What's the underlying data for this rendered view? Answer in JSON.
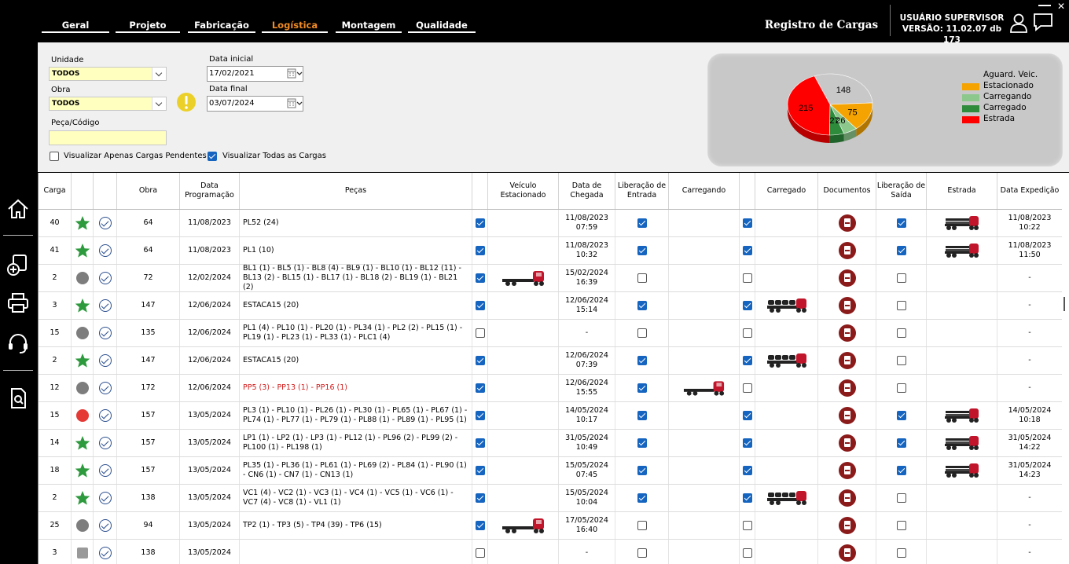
{
  "nav": {
    "tabs": [
      {
        "label": "Geral",
        "active": false
      },
      {
        "label": "Projeto",
        "active": false
      },
      {
        "label": "Fabricação",
        "active": false
      },
      {
        "label": "Logística",
        "active": true
      },
      {
        "label": "Montagem",
        "active": false
      },
      {
        "label": "Qualidade",
        "active": false
      }
    ],
    "app_title": "Registro de Cargas",
    "user": "USUÁRIO SUPERVISOR",
    "version": "VERSÃO: 11.02.07 db 173",
    "close": "✕"
  },
  "sidebar": [
    "home-icon",
    "add-document-icon",
    "printer-icon",
    "headset-icon",
    "search-document-icon"
  ],
  "filters": {
    "unidade_label": "Unidade",
    "unidade_value": "TODOS",
    "obra_label": "Obra",
    "obra_value": "TODOS",
    "peca_label": "Peça/Código",
    "peca_value": "",
    "data_inicial_label": "Data inicial",
    "data_inicial": "17/02/2021",
    "data_final_label": "Data final",
    "data_final": "03/07/2024",
    "pendentes_label": "Visualizar Apenas Cargas Pendentes",
    "pendentes_checked": false,
    "todas_label": "Visualizar Todas as Cargas",
    "todas_checked": true
  },
  "chart_data": {
    "type": "pie",
    "title": "",
    "labels": [
      "Aguard. Veic.",
      "Estacionado",
      "Carregando",
      "Carregado",
      "Estrada"
    ],
    "values": [
      148,
      75,
      26,
      27,
      215
    ],
    "colors": [
      "#c8c8c8",
      "#f5a300",
      "#8cc88c",
      "#2e8b3c",
      "#ff0000"
    ],
    "legend_position": "right"
  },
  "table": {
    "headers": [
      {
        "label": "Carga"
      },
      {
        "label": ""
      },
      {
        "label": ""
      },
      {
        "label": "Obra"
      },
      {
        "label": "Data Programação"
      },
      {
        "label": "Peças"
      },
      {
        "label": ""
      },
      {
        "label": "Veículo Estacionado"
      },
      {
        "label": "Data de Chegada"
      },
      {
        "label": "Liberação de Entrada"
      },
      {
        "label": "Carregando"
      },
      {
        "label": ""
      },
      {
        "label": "Carregado"
      },
      {
        "label": "Documentos"
      },
      {
        "label": "Liberação de Saída"
      },
      {
        "label": "Estrada"
      },
      {
        "label": "Data Expedição"
      }
    ],
    "rows": [
      {
        "carga": "40",
        "status": "star",
        "obra": "64",
        "data_prog": "11/08/2023",
        "pecas": "PL52 (24)",
        "pecas_red": false,
        "cb1": true,
        "veic": "",
        "chegada": "11/08/2023\n07:59",
        "lib_ent": true,
        "carregando": "",
        "cb2": true,
        "carregado": "",
        "lib_saida": true,
        "estrada": "loaded-trailer",
        "expedicao": "11/08/2023\n10:22"
      },
      {
        "carga": "41",
        "status": "star",
        "obra": "64",
        "data_prog": "11/08/2023",
        "pecas": "PL1 (10)",
        "pecas_red": false,
        "cb1": true,
        "veic": "",
        "chegada": "11/08/2023\n10:32",
        "lib_ent": true,
        "carregando": "",
        "cb2": true,
        "carregado": "",
        "lib_saida": true,
        "estrada": "loaded-trailer",
        "expedicao": "11/08/2023\n11:50"
      },
      {
        "carga": "2",
        "status": "grey",
        "obra": "72",
        "data_prog": "12/02/2024",
        "pecas": "BL1 (1) - BL5 (1) - BL8 (4) - BL9 (1) - BL10 (1) - BL12 (11) - BL13 (2) - BL15 (1) - BL17 (1) - BL18 (2) - BL19 (1) - BL21 (2)",
        "pecas_red": false,
        "cb1": true,
        "veic": "trailer",
        "chegada": "15/02/2024\n16:39",
        "lib_ent": false,
        "carregando": "",
        "cb2": false,
        "carregado": "",
        "lib_saida": false,
        "estrada": "",
        "expedicao": "-"
      },
      {
        "carga": "3",
        "status": "star",
        "obra": "147",
        "data_prog": "12/06/2024",
        "pecas": "ESTACA15 (20)",
        "pecas_red": false,
        "cb1": true,
        "veic": "",
        "chegada": "12/06/2024\n15:14",
        "lib_ent": true,
        "carregando": "",
        "cb2": true,
        "carregado": "truck-load",
        "lib_saida": false,
        "estrada": "",
        "expedicao": "-"
      },
      {
        "carga": "15",
        "status": "grey",
        "obra": "135",
        "data_prog": "12/06/2024",
        "pecas": "PL1 (4) - PL10 (1) - PL20 (1) - PL34 (1) - PL2 (2) - PL15 (1) - PL19 (1) - PL23 (1) - PL33 (1) - PLC1 (4)",
        "pecas_red": false,
        "cb1": false,
        "veic": "",
        "chegada": "-",
        "lib_ent": false,
        "carregando": "",
        "cb2": false,
        "carregado": "",
        "lib_saida": false,
        "estrada": "",
        "expedicao": "-"
      },
      {
        "carga": "2",
        "status": "star",
        "obra": "147",
        "data_prog": "12/06/2024",
        "pecas": "ESTACA15 (20)",
        "pecas_red": false,
        "cb1": true,
        "veic": "",
        "chegada": "12/06/2024\n07:39",
        "lib_ent": true,
        "carregando": "",
        "cb2": true,
        "carregado": "truck-load",
        "lib_saida": false,
        "estrada": "",
        "expedicao": "-"
      },
      {
        "carga": "12",
        "status": "grey",
        "obra": "172",
        "data_prog": "12/06/2024",
        "pecas": "PP5 (3) - PP13 (1) - PP16 (1)",
        "pecas_red": true,
        "cb1": true,
        "veic": "",
        "chegada": "12/06/2024\n15:55",
        "lib_ent": true,
        "carregando": "trailer-small",
        "cb2": false,
        "carregado": "",
        "lib_saida": false,
        "estrada": "",
        "expedicao": "-"
      },
      {
        "carga": "15",
        "status": "red",
        "obra": "157",
        "data_prog": "13/05/2024",
        "pecas": "PL3 (1) - PL10 (1) - PL26 (1) - PL30 (1) - PL65 (1) - PL67 (1) - PL74 (1) - PL77 (1) - PL79 (1) - PL88 (1) - PL89 (1) - PL95 (1)",
        "pecas_red": false,
        "cb1": true,
        "veic": "",
        "chegada": "14/05/2024\n10:17",
        "lib_ent": true,
        "carregando": "",
        "cb2": true,
        "carregado": "",
        "lib_saida": true,
        "estrada": "loaded-trailer",
        "expedicao": "14/05/2024\n10:18"
      },
      {
        "carga": "14",
        "status": "star",
        "obra": "157",
        "data_prog": "13/05/2024",
        "pecas": "LP1 (1) - LP2 (1) - LP3 (1) - PL12 (1) - PL96 (2) - PL99 (2) - PL100 (1) - PL198 (1)",
        "pecas_red": false,
        "cb1": true,
        "veic": "",
        "chegada": "31/05/2024\n10:49",
        "lib_ent": true,
        "carregando": "",
        "cb2": true,
        "carregado": "",
        "lib_saida": true,
        "estrada": "loaded-trailer",
        "expedicao": "31/05/2024\n14:22"
      },
      {
        "carga": "18",
        "status": "star",
        "obra": "157",
        "data_prog": "13/05/2024",
        "pecas": "PL35 (1) - PL36 (1) - PL61 (1) - PL69 (2) - PL84 (1) - PL90 (1) - CN6 (1) - CN7 (1) - CN13 (1)",
        "pecas_red": false,
        "cb1": true,
        "veic": "",
        "chegada": "15/05/2024\n07:45",
        "lib_ent": true,
        "carregando": "",
        "cb2": true,
        "carregado": "",
        "lib_saida": true,
        "estrada": "loaded-trailer",
        "expedicao": "31/05/2024\n14:23"
      },
      {
        "carga": "2",
        "status": "star",
        "obra": "138",
        "data_prog": "13/05/2024",
        "pecas": "VC1 (4) - VC2 (1) - VC3 (1) - VC4 (1) - VC5 (1) - VC6 (1) - VC7 (4) - VC8 (1) - VL1 (1)",
        "pecas_red": false,
        "cb1": true,
        "veic": "",
        "chegada": "15/05/2024\n10:04",
        "lib_ent": true,
        "carregando": "",
        "cb2": true,
        "carregado": "truck-load",
        "lib_saida": false,
        "estrada": "",
        "expedicao": "-"
      },
      {
        "carga": "25",
        "status": "grey",
        "obra": "94",
        "data_prog": "13/05/2024",
        "pecas": "TP2 (1) - TP3 (5) - TP4 (39) - TP6 (15)",
        "pecas_red": false,
        "cb1": true,
        "veic": "trailer",
        "chegada": "17/05/2024\n16:40",
        "lib_ent": false,
        "carregando": "",
        "cb2": false,
        "carregado": "",
        "lib_saida": false,
        "estrada": "",
        "expedicao": "-"
      },
      {
        "carga": "3",
        "status": "square",
        "obra": "138",
        "data_prog": "13/05/2024",
        "pecas": "",
        "pecas_red": false,
        "cb1": false,
        "veic": "",
        "chegada": "-",
        "lib_ent": false,
        "carregando": "",
        "cb2": false,
        "carregado": "",
        "lib_saida": false,
        "estrada": "",
        "expedicao": "-"
      }
    ]
  }
}
